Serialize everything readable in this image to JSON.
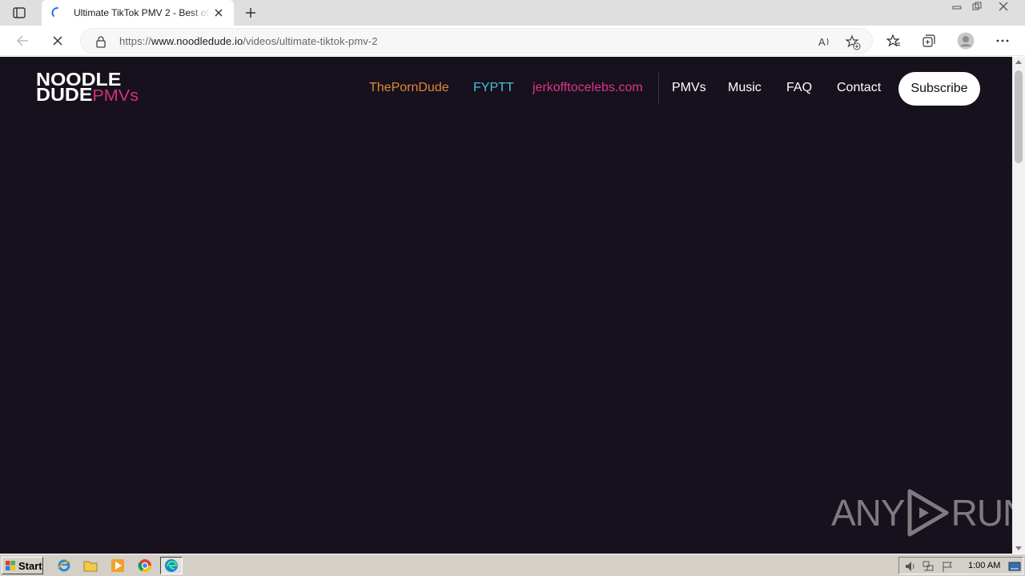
{
  "browser": {
    "tab": {
      "title": "Ultimate TikTok PMV 2 - Best of"
    },
    "address": {
      "scheme": "https://",
      "host": "www.noodledude.io",
      "path": "/videos/ultimate-tiktok-pmv-2"
    }
  },
  "site": {
    "logo": {
      "line1": "NOODLE",
      "line2": "DUDE",
      "suffix": "PMVs"
    },
    "nav": {
      "partner_links": [
        {
          "label": "ThePornDude",
          "color": "#e0873a"
        },
        {
          "label": "FYPTT",
          "color": "#44c2e4"
        },
        {
          "label": "jerkofftocelebs.com",
          "color": "#e0338a"
        }
      ],
      "links": [
        "PMVs",
        "Music",
        "FAQ",
        "Contact"
      ],
      "subscribe": "Subscribe"
    },
    "background_color": "#16111c"
  },
  "watermark": {
    "left": "ANY",
    "right": "RUN"
  },
  "taskbar": {
    "start_label": "Start",
    "clock": "1:00 AM"
  }
}
